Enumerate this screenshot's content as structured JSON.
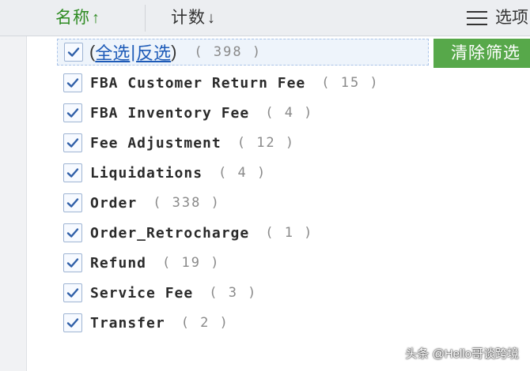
{
  "header": {
    "name_label": "名称",
    "name_arrow": "↑",
    "count_label": "计数",
    "count_arrow": "↓",
    "options_label": "选项"
  },
  "colors": {
    "accent_green": "#57a84a",
    "header_green_text": "#2e8b22",
    "link_blue": "#1e5bb8"
  },
  "select_all": {
    "open_paren": "(",
    "select_all_label": "全选",
    "separator": "|",
    "invert_label": "反选",
    "close_paren": ")",
    "count": "( 398 )"
  },
  "clear_filter_label": "清除筛选",
  "items": [
    {
      "label": "FBA Customer Return Fee",
      "count": "( 15 )",
      "checked": true
    },
    {
      "label": "FBA Inventory Fee",
      "count": "( 4 )",
      "checked": true
    },
    {
      "label": "Fee Adjustment",
      "count": "( 12 )",
      "checked": true
    },
    {
      "label": "Liquidations",
      "count": "( 4 )",
      "checked": true
    },
    {
      "label": "Order",
      "count": "( 338 )",
      "checked": true
    },
    {
      "label": "Order_Retrocharge",
      "count": "( 1 )",
      "checked": true
    },
    {
      "label": "Refund",
      "count": "( 19 )",
      "checked": true
    },
    {
      "label": "Service Fee",
      "count": "( 3 )",
      "checked": true
    },
    {
      "label": "Transfer",
      "count": "( 2 )",
      "checked": true
    }
  ],
  "watermark": "头条 @Hello哥谈跨境"
}
